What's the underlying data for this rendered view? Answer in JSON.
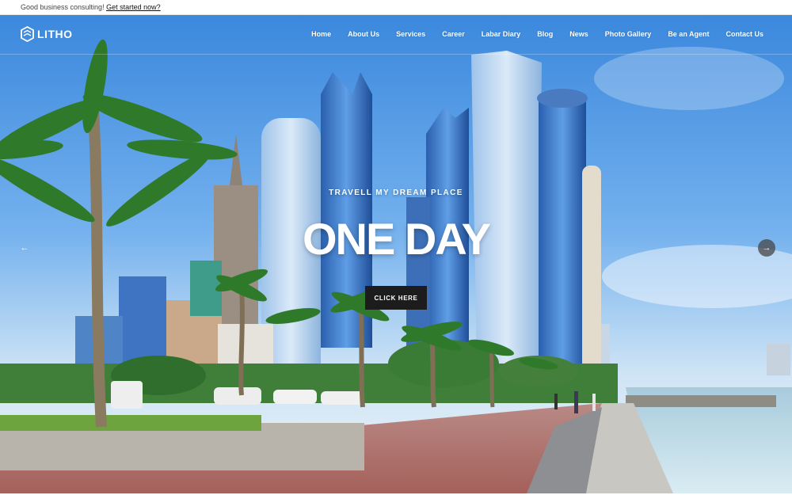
{
  "topbar": {
    "text": "Good business consulting!",
    "link": "Get started now?"
  },
  "header": {
    "logo_text": "LITHO",
    "nav": [
      "Home",
      "About Us",
      "Services",
      "Career",
      "Labar Diary",
      "Blog",
      "News",
      "Photo Gallery",
      "Be an Agent",
      "Contact Us"
    ]
  },
  "hero": {
    "eyebrow": "TRAVELL MY DREAM PLACE",
    "headline": "ONE DAY",
    "cta_label": "CLICK HERE",
    "prev_icon": "arrow-left-icon",
    "next_icon": "arrow-right-icon",
    "prev_glyph": "←",
    "next_glyph": "→"
  },
  "colors": {
    "sky": "#3f8fe0",
    "cta_bg": "#1c1c1c",
    "text": "#ffffff"
  }
}
